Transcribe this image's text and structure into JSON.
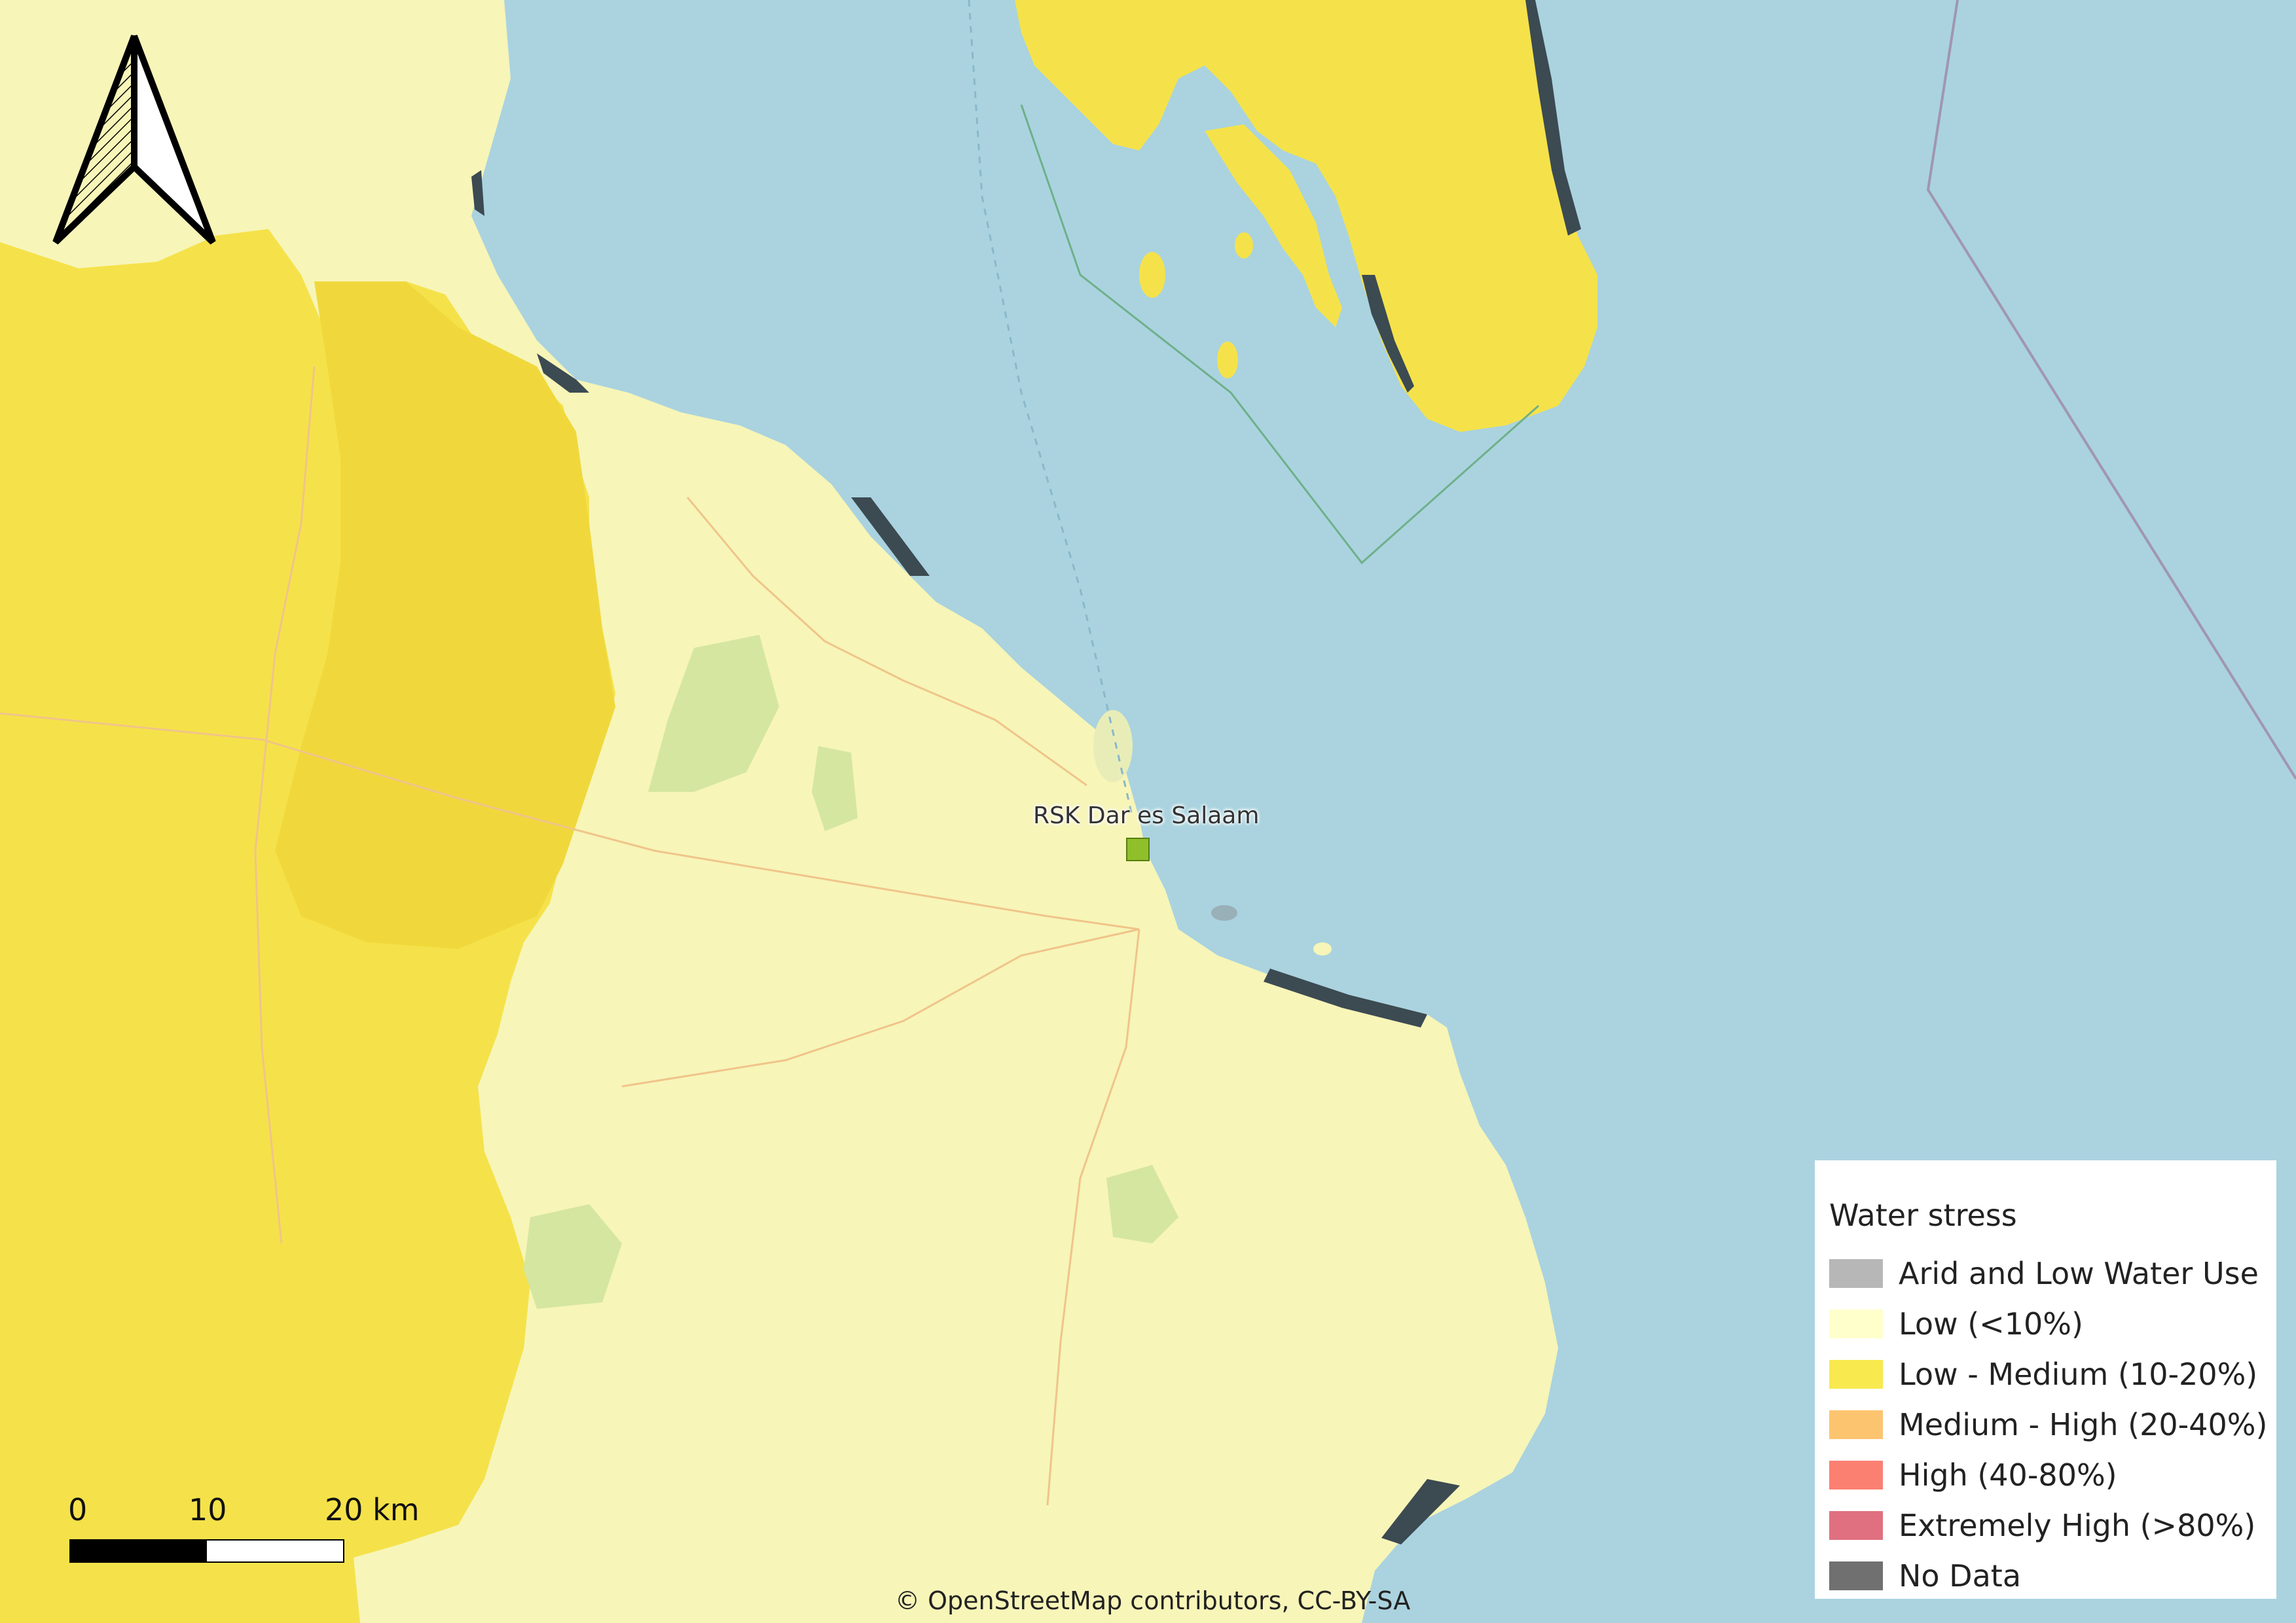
{
  "legend": {
    "title": "Water stress",
    "items": [
      {
        "label": "Arid and Low Water Use",
        "color": "#b7b7b7"
      },
      {
        "label": "Low (<10%)",
        "color": "#ffffcc"
      },
      {
        "label": "Low - Medium (10-20%)",
        "color": "#f8e94e"
      },
      {
        "label": "Medium - High (20-40%)",
        "color": "#fdc470"
      },
      {
        "label": "High (40-80%)",
        "color": "#fb8072"
      },
      {
        "label": "Extremely High (>80%)",
        "color": "#e07080"
      },
      {
        "label": "No Data",
        "color": "#707070"
      }
    ]
  },
  "site": {
    "label": "RSK Dar es Salaam",
    "color": "#8fbf2a"
  },
  "scale": {
    "labels": [
      "0",
      "10",
      "20 km"
    ]
  },
  "attribution": "© OpenStreetMap contributors, CC-BY-SA",
  "colors": {
    "water": "#aad3df",
    "low": "#f7f5b8",
    "low_medium": "#f5e24a",
    "no_data_shadow": "#3c4a52"
  }
}
